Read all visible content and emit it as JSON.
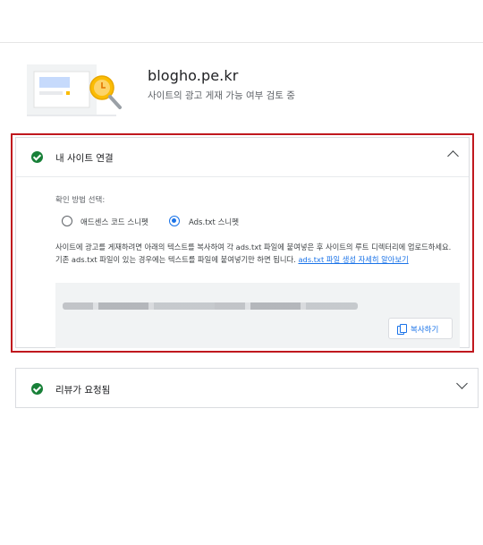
{
  "site": {
    "domain": "blogho.pe.kr",
    "status": "사이트의 광고 게재 가능 여부 검토 중"
  },
  "connect_panel": {
    "title": "내 사이트 연결",
    "expanded": true,
    "method_label": "확인 방법 선택:",
    "options": [
      {
        "label": "애드센스 코드 스니펫",
        "selected": false
      },
      {
        "label": "Ads.txt 스니펫",
        "selected": true
      }
    ],
    "description": "사이트에 광고를 게재하려면 아래의 텍스트를 복사하여 각 ads.txt 파일에 붙여넣은 후 사이트의 루트 디렉터리에 업로드하세요. 기존 ads.txt 파일이 있는 경우에는 텍스트를 파일에 붙여넣기만 하면 됩니다. ",
    "link_text": "ads.txt 파일 생성 자세히 알아보기",
    "copy_button": "복사하기"
  },
  "review_panel": {
    "title": "리뷰가 요청됨",
    "expanded": false
  },
  "colors": {
    "accent": "#1a73e8",
    "success": "#188038",
    "highlight": "#c0181e"
  }
}
